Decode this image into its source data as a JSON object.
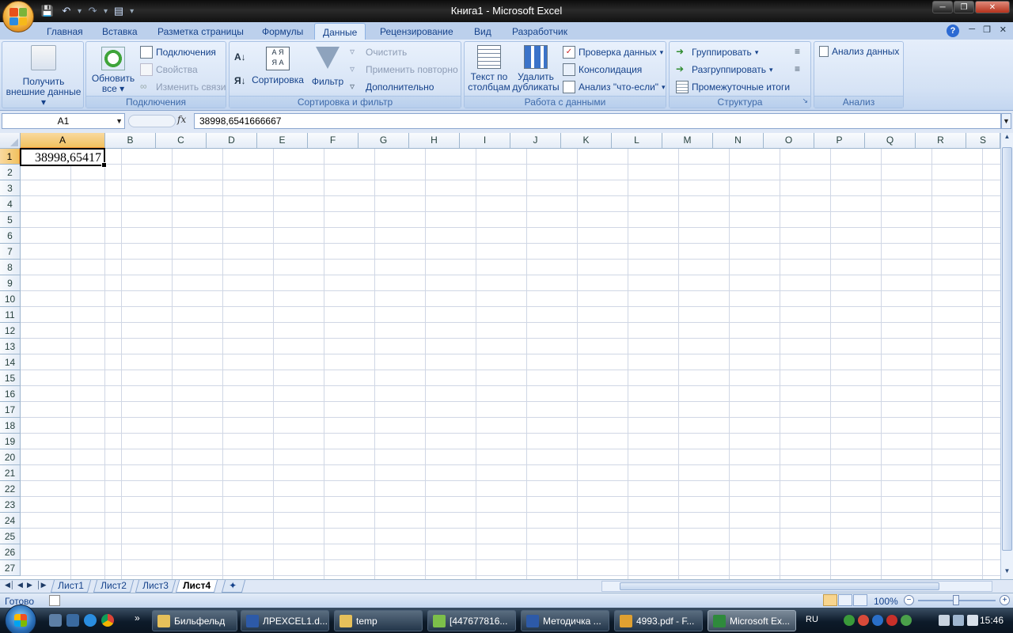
{
  "window": {
    "title": "Книга1 - Microsoft Excel"
  },
  "tabs": [
    "Главная",
    "Вставка",
    "Разметка страницы",
    "Формулы",
    "Данные",
    "Рецензирование",
    "Вид",
    "Разработчик"
  ],
  "ribbon": {
    "get_external_line1": "Получить",
    "get_external_line2": "внешние данные",
    "refresh_line1": "Обновить",
    "refresh_line2": "все",
    "connections": "Подключения",
    "properties": "Свойства",
    "edit_links": "Изменить связи",
    "group_connections": "Подключения",
    "sort": "Сортировка",
    "filter": "Фильтр",
    "clear": "Очистить",
    "reapply": "Применить повторно",
    "advanced": "Дополнительно",
    "group_sort": "Сортировка и фильтр",
    "text_to_cols_line1": "Текст по",
    "text_to_cols_line2": "столбцам",
    "remove_dup_line1": "Удалить",
    "remove_dup_line2": "дубликаты",
    "data_validation": "Проверка данных",
    "consolidate": "Консолидация",
    "what_if": "Анализ \"что-если\"",
    "group_data_tools": "Работа с данными",
    "group_btn": "Группировать",
    "ungroup_btn": "Разгруппировать",
    "subtotal": "Промежуточные итоги",
    "group_outline": "Структура",
    "data_analysis": "Анализ данных",
    "group_analysis": "Анализ"
  },
  "formula_bar": {
    "name_box": "A1",
    "fx": "fx",
    "value": "38998,6541666667"
  },
  "columns": [
    "A",
    "B",
    "C",
    "D",
    "E",
    "F",
    "G",
    "H",
    "I",
    "J",
    "K",
    "L",
    "M",
    "N",
    "O",
    "P",
    "Q",
    "R",
    "S"
  ],
  "rows": [
    "1",
    "2",
    "3",
    "4",
    "5",
    "6",
    "7",
    "8",
    "9",
    "10",
    "11",
    "12",
    "13",
    "14",
    "15",
    "16",
    "17",
    "18",
    "19",
    "20",
    "21",
    "22",
    "23",
    "24",
    "25",
    "26",
    "27"
  ],
  "cell_a1": "38998,65417",
  "sheets": [
    "Лист1",
    "Лист2",
    "Лист3",
    "Лист4"
  ],
  "status": {
    "ready": "Готово",
    "zoom": "100%"
  },
  "taskbar": {
    "items": [
      "Бильфельд",
      "ЛРEXCEL1.d...",
      "temp",
      "[447677816...",
      "Методичка ...",
      "4993.pdf - F...",
      "Microsoft Ex..."
    ],
    "lang": "RU",
    "time": "15:46"
  }
}
